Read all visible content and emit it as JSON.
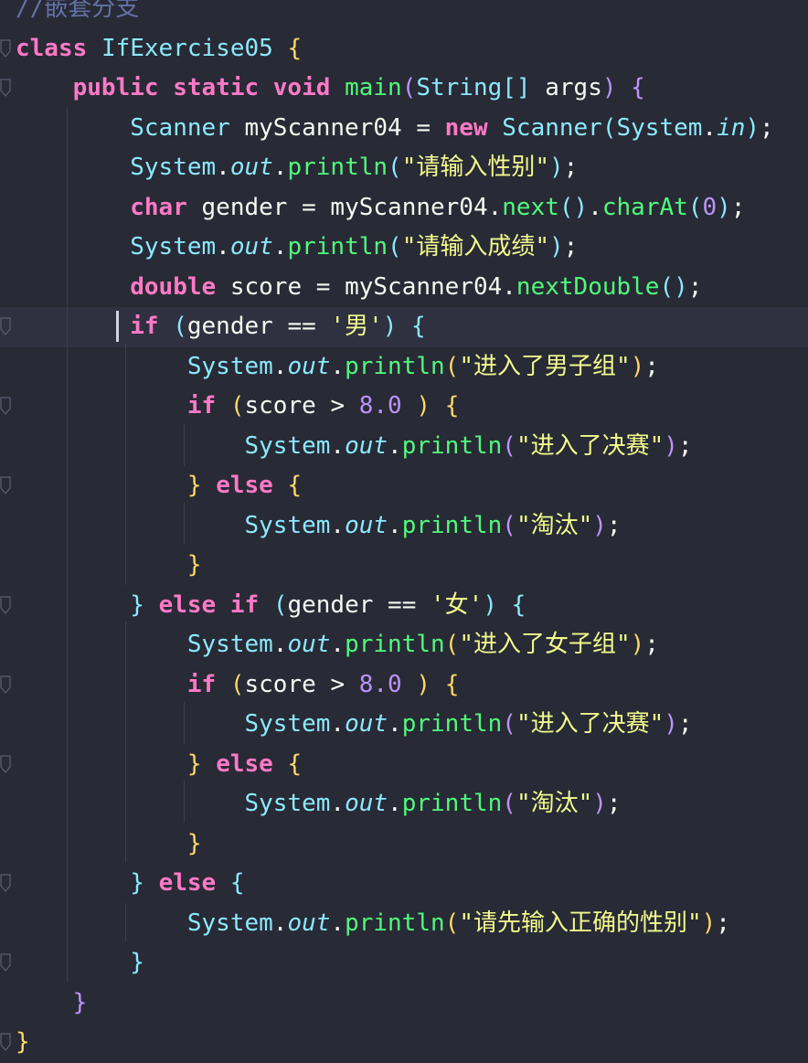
{
  "editor": {
    "language": "java",
    "current_line": 9,
    "lines": [
      "//嵌套分支",
      "class IfExercise05 {",
      "    public static void main(String[] args) {",
      "        Scanner myScanner04 = new Scanner(System.in);",
      "        System.out.println(\"请输入性别\");",
      "        char gender = myScanner04.next().charAt(0);",
      "        System.out.println(\"请输入成绩\");",
      "        double score = myScanner04.nextDouble();",
      "        if (gender == '男') {",
      "            System.out.println(\"进入了男子组\");",
      "            if (score > 8.0 ) {",
      "                System.out.println(\"进入了决赛\");",
      "            } else {",
      "                System.out.println(\"淘汰\");",
      "            }",
      "        } else if (gender == '女') {",
      "            System.out.println(\"进入了女子组\");",
      "            if (score > 8.0 ) {",
      "                System.out.println(\"进入了决赛\");",
      "            } else {",
      "                System.out.println(\"淘汰\");",
      "            }",
      "        } else {",
      "            System.out.println(\"请先输入正确的性别\");",
      "        }",
      "    }",
      "}"
    ]
  },
  "colors": {
    "background": "#282a36",
    "current_line": "#2f3140",
    "keyword": "#ff79c6",
    "class": "#8be9fd",
    "method": "#50fa7b",
    "string": "#f1fa8c",
    "number": "#bd93f9",
    "comment": "#6272a4"
  }
}
